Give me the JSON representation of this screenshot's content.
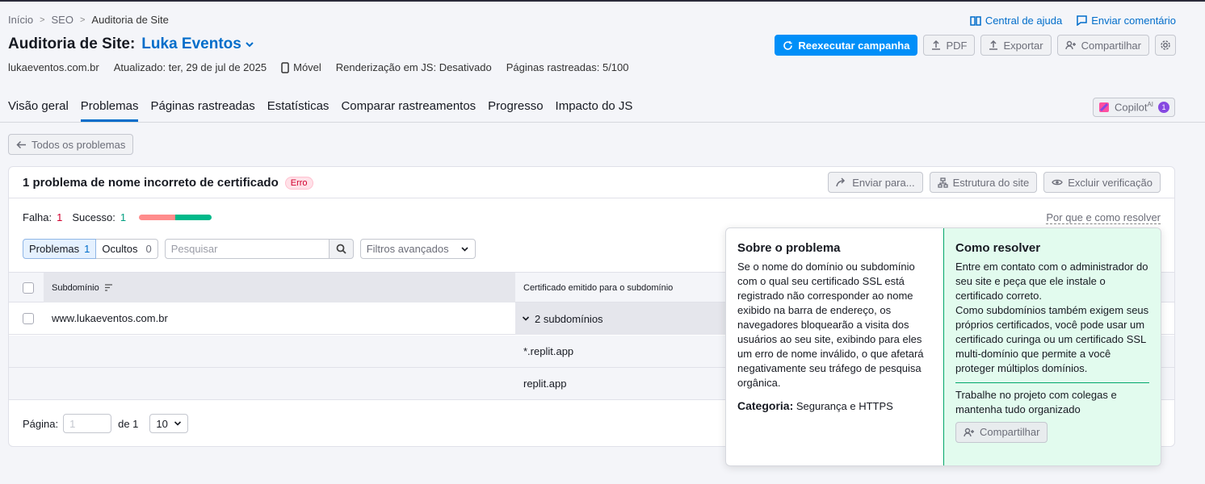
{
  "breadcrumbs": [
    "Início",
    "SEO",
    "Auditoria de Site"
  ],
  "header": {
    "title_prefix": "Auditoria de Site:",
    "project_name": "Luka Eventos",
    "help_link": "Central de ajuda",
    "feedback_link": "Enviar comentário",
    "rerun_label": "Reexecutar campanha",
    "pdf_label": "PDF",
    "export_label": "Exportar",
    "share_label": "Compartilhar"
  },
  "meta": {
    "domain": "lukaeventos.com.br",
    "updated": "Atualizado: ter, 29 de jul de 2025",
    "device": "Móvel",
    "js_render": "Renderização em JS: Desativado",
    "pages_crawled": "Páginas rastreadas: 5/100"
  },
  "tabs": [
    "Visão geral",
    "Problemas",
    "Páginas rastreadas",
    "Estatísticas",
    "Comparar rastreamentos",
    "Progresso",
    "Impacto do JS"
  ],
  "active_tab": "Problemas",
  "copilot": {
    "label": "Copilot",
    "sup": "AI",
    "count": "1"
  },
  "back_label": "Todos os problemas",
  "issue": {
    "title": "1 problema de nome incorreto de certificado",
    "badge": "Erro",
    "send_label": "Enviar para...",
    "structure_label": "Estrutura do site",
    "exclude_label": "Excluir verificação",
    "fail_label": "Falha:",
    "fail_count": "1",
    "success_label": "Sucesso:",
    "success_count": "1",
    "fail_ratio": 0.5,
    "why_link": "Por que e como resolver"
  },
  "filters": {
    "problems_label": "Problemas",
    "problems_count": "1",
    "hidden_label": "Ocultos",
    "hidden_count": "0",
    "search_placeholder": "Pesquisar",
    "advanced_label": "Filtros avançados"
  },
  "table": {
    "col_subdomain": "Subdomínio",
    "col_cert": "Certificado emitido para o subdomínio",
    "row_domain": "www.lukaeventos.com.br",
    "row_expand": "2 subdomínios",
    "sub_rows": [
      "*.replit.app",
      "replit.app"
    ]
  },
  "pagination": {
    "page_label": "Página:",
    "page_value": "1",
    "of_label": "de 1",
    "per_page": "10"
  },
  "popup": {
    "about_title": "Sobre o problema",
    "about_text": "Se o nome do domínio ou subdomínio com o qual seu certificado SSL está registrado não corresponder ao nome exibido na barra de endereço, os navegadores bloquearão a visita dos usuários ao seu site, exibindo para eles um erro de nome inválido, o que afetará negativamente seu tráfego de pesquisa orgânica.",
    "category_label": "Categoria:",
    "category_value": "Segurança e HTTPS",
    "fix_title": "Como resolver",
    "fix_text_1": "Entre em contato com o administrador do seu site e peça que ele instale o certificado correto.",
    "fix_text_2": "Como subdomínios também exigem seus próprios certificados, você pode usar um certificado curinga ou um certificado SSL multi-domínio que permite a você proteger múltiplos domínios.",
    "collab_text": "Trabalhe no projeto com colegas e mantenha tudo organizado",
    "share_label": "Compartilhar"
  }
}
